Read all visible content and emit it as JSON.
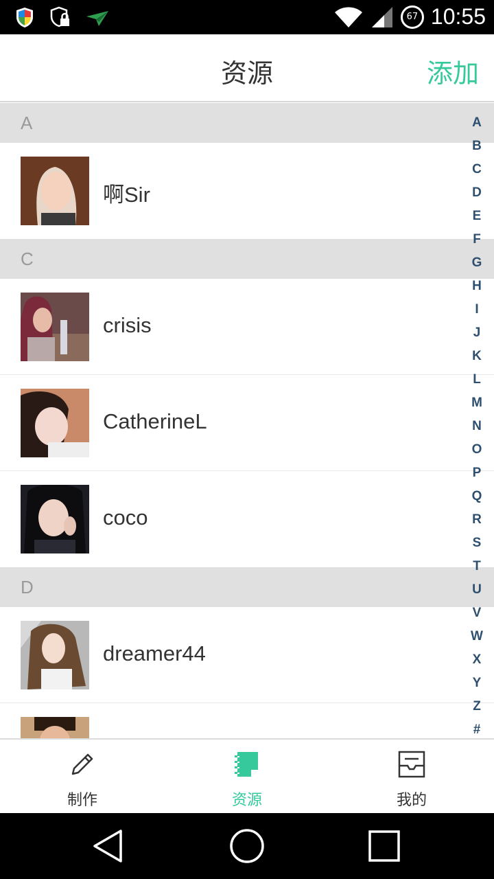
{
  "status_bar": {
    "time": "10:55",
    "battery_level": "67",
    "icons": [
      "shield-icon",
      "lock-shield-icon",
      "paper-plane-icon",
      "wifi-icon",
      "signal-icon"
    ]
  },
  "header": {
    "title": "资源",
    "action_label": "添加",
    "accent_color": "#35c99b"
  },
  "sections": [
    {
      "letter": "A",
      "items": [
        {
          "name": "啊Sir"
        }
      ]
    },
    {
      "letter": "C",
      "items": [
        {
          "name": "crisis"
        },
        {
          "name": "CatherineL"
        },
        {
          "name": "coco"
        }
      ]
    },
    {
      "letter": "D",
      "items": [
        {
          "name": "dreamer44"
        },
        {
          "name": ""
        }
      ]
    }
  ],
  "alpha_index": [
    "A",
    "B",
    "C",
    "D",
    "E",
    "F",
    "G",
    "H",
    "I",
    "J",
    "K",
    "L",
    "M",
    "N",
    "O",
    "P",
    "Q",
    "R",
    "S",
    "T",
    "U",
    "V",
    "W",
    "X",
    "Y",
    "Z",
    "#"
  ],
  "tabs": [
    {
      "label": "制作",
      "icon": "pencil-icon",
      "active": false
    },
    {
      "label": "资源",
      "icon": "notebook-icon",
      "active": true
    },
    {
      "label": "我的",
      "icon": "inbox-icon",
      "active": false
    }
  ],
  "nav": [
    "back-icon",
    "home-icon",
    "recents-icon"
  ]
}
